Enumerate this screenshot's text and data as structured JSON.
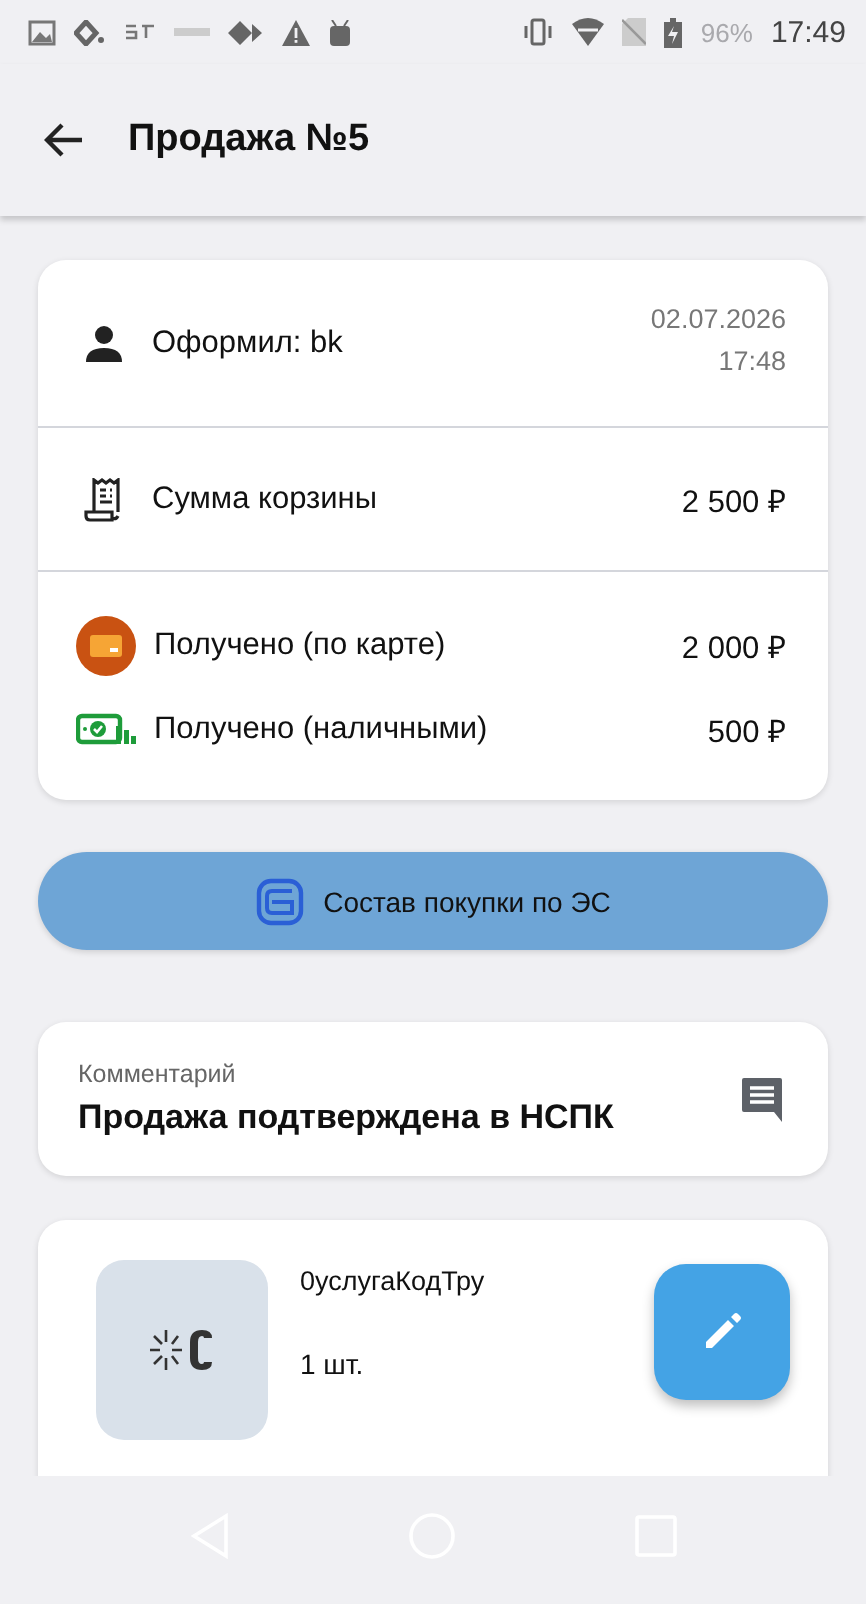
{
  "status_bar": {
    "battery": "96%",
    "time": "17:49"
  },
  "app_bar": {
    "title": "Продажа №5"
  },
  "summary": {
    "author": "Оформил: bk",
    "date": "02.07.2026",
    "time": "17:48",
    "total_label": "Сумма корзины",
    "total": "2 500 ₽",
    "payments": [
      {
        "kind": "card",
        "label": "Получено (по карте)",
        "amount": "2 000 ₽"
      },
      {
        "kind": "cash",
        "label": "Получено (наличными)",
        "amount": "500 ₽"
      }
    ]
  },
  "composition_button": "Состав покупки по ЭС",
  "comment": {
    "label": "Комментарий",
    "text": "Продажа подтверждена в НСПК"
  },
  "items": [
    {
      "name": "0услугаКодТру",
      "quantity": "1 шт."
    }
  ]
}
